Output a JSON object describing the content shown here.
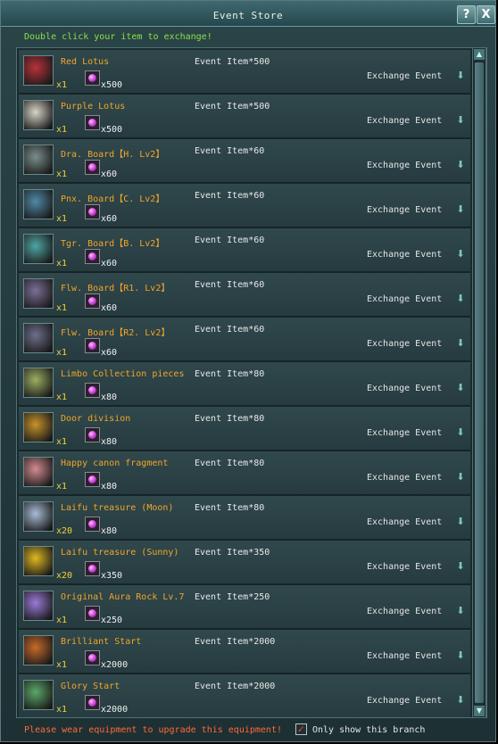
{
  "window": {
    "title": "Event Store",
    "help_label": "?",
    "close_label": "X"
  },
  "hint": "Double click your item to exchange!",
  "items": [
    {
      "name": "Red Lotus",
      "price": "Event Item*500",
      "qty": "x1",
      "token_count": "x500",
      "action": "Exchange Event",
      "icon_color": "#b8323a"
    },
    {
      "name": "Purple Lotus",
      "price": "Event Item*500",
      "qty": "x1",
      "token_count": "x500",
      "action": "Exchange Event",
      "icon_color": "#d8d4c8"
    },
    {
      "name": "Dra. Board【H. Lv2】",
      "price": "Event Item*60",
      "qty": "x1",
      "token_count": "x60",
      "action": "Exchange Event",
      "icon_color": "#7a8f8c"
    },
    {
      "name": "Pnx. Board【C. Lv2】",
      "price": "Event Item*60",
      "qty": "x1",
      "token_count": "x60",
      "action": "Exchange Event",
      "icon_color": "#4f8aa6"
    },
    {
      "name": "Tgr. Board【B. Lv2】",
      "price": "Event Item*60",
      "qty": "x1",
      "token_count": "x60",
      "action": "Exchange Event",
      "icon_color": "#4fa6a4"
    },
    {
      "name": "Flw. Board【R1. Lv2】",
      "price": "Event Item*60",
      "qty": "x1",
      "token_count": "x60",
      "action": "Exchange Event",
      "icon_color": "#7c6f96"
    },
    {
      "name": "Flw. Board【R2. Lv2】",
      "price": "Event Item*60",
      "qty": "x1",
      "token_count": "x60",
      "action": "Exchange Event",
      "icon_color": "#6d6f8c"
    },
    {
      "name": "Limbo Collection pieces",
      "price": "Event Item*80",
      "qty": "x1",
      "token_count": "x80",
      "action": "Exchange Event",
      "icon_color": "#9caf62"
    },
    {
      "name": "Door division",
      "price": "Event Item*80",
      "qty": "x1",
      "token_count": "x80",
      "action": "Exchange Event",
      "icon_color": "#c8922a"
    },
    {
      "name": "Happy canon fragment",
      "price": "Event Item*80",
      "qty": "x1",
      "token_count": "x80",
      "action": "Exchange Event",
      "icon_color": "#d48a90"
    },
    {
      "name": "Laifu treasure (Moon)",
      "price": "Event Item*80",
      "qty": "x20",
      "token_count": "x80",
      "action": "Exchange Event",
      "icon_color": "#a8bcd6"
    },
    {
      "name": "Laifu treasure (Sunny)",
      "price": "Event Item*350",
      "qty": "x20",
      "token_count": "x350",
      "action": "Exchange Event",
      "icon_color": "#e0b820"
    },
    {
      "name": "Original Aura Rock Lv.7",
      "price": "Event Item*250",
      "qty": "x1",
      "token_count": "x250",
      "action": "Exchange Event",
      "icon_color": "#9a7ad8"
    },
    {
      "name": "Brilliant Start",
      "price": "Event Item*2000",
      "qty": "x1",
      "token_count": "x2000",
      "action": "Exchange Event",
      "icon_color": "#c86a2a"
    },
    {
      "name": "Glory Start",
      "price": "Event Item*2000",
      "qty": "x1",
      "token_count": "x2000",
      "action": "Exchange Event",
      "icon_color": "#5aa86a"
    }
  ],
  "footer": {
    "warning": "Please wear equipment to upgrade this equipment!",
    "checkbox_label": "Only show this branch",
    "checkbox_checked": true,
    "check_glyph": "✓"
  }
}
